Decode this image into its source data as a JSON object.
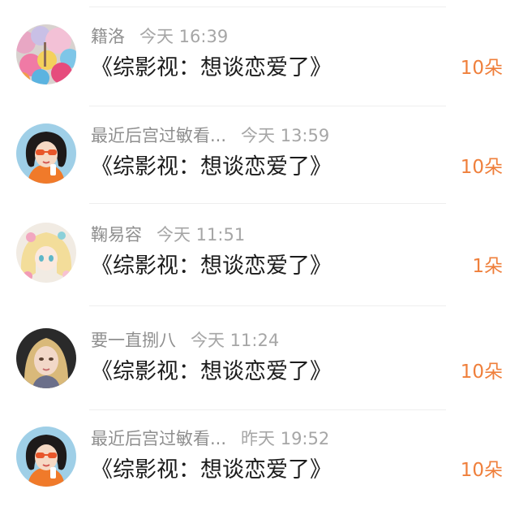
{
  "items": [
    {
      "user": "籍洛",
      "time": "今天 16:39",
      "title": "《综影视：想谈恋爱了》",
      "count": "10朵",
      "avatar": "balloons-avatar"
    },
    {
      "user": "最近后宫过敏看...",
      "time": "今天 13:59",
      "title": "《综影视：想谈恋爱了》",
      "count": "10朵",
      "avatar": "girl-sunglasses-avatar"
    },
    {
      "user": "鞠易容",
      "time": "今天 11:51",
      "title": "《综影视：想谈恋爱了》",
      "count": "1朵",
      "avatar": "anime-girl-avatar"
    },
    {
      "user": "要一直捌八",
      "time": "今天 11:24",
      "title": "《综影视：想谈恋爱了》",
      "count": "10朵",
      "avatar": "blonde-girl-avatar"
    },
    {
      "user": "最近后宫过敏看...",
      "time": "昨天 19:52",
      "title": "《综影视：想谈恋爱了》",
      "count": "10朵",
      "avatar": "girl-sunglasses-avatar"
    }
  ],
  "colors": {
    "accent": "#ef7f3b",
    "meta": "#8f8f8f",
    "title": "#1c1c1c"
  }
}
